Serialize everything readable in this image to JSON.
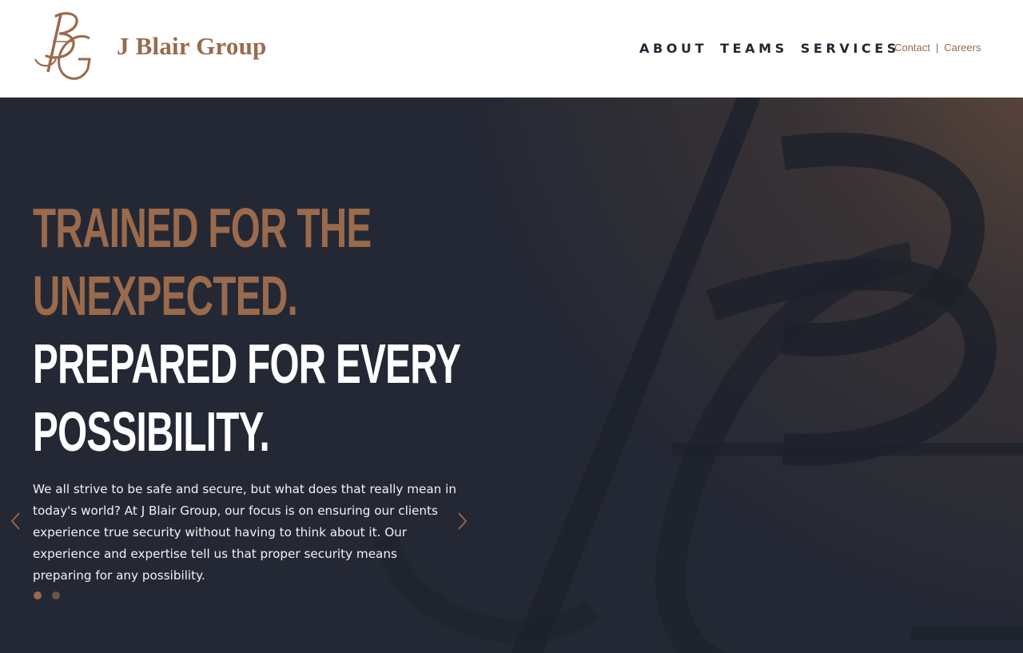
{
  "brand": {
    "monogram_letters": "BG",
    "name": "J Blair Group"
  },
  "nav": {
    "items": [
      {
        "label": "ABOUT"
      },
      {
        "label": "TEAMS"
      },
      {
        "label": "SERVICES"
      }
    ]
  },
  "utility_links": {
    "contact": "Contact",
    "separator": "|",
    "careers": "Careers"
  },
  "hero": {
    "headline_accent_line1": "TRAINED FOR THE",
    "headline_accent_line2": "UNEXPECTED.",
    "headline_light_line1": "PREPARED FOR EVERY",
    "headline_light_line2": "POSSIBILITY.",
    "body": "We all strive to be safe and secure, but what does that really mean in today's world? At J Blair Group, our focus is on ensuring our clients experience true security without having to think about it. Our experience and expertise tell us that proper security means preparing for any possibility.",
    "slides": {
      "count": 2,
      "active": 1
    }
  },
  "icons": {
    "prev": "chevron-left-icon",
    "next": "chevron-right-icon",
    "logo": "bg-monogram-icon",
    "background": "bg-monogram-watermark"
  },
  "colors": {
    "brand_copper": "#9a6a4c",
    "nav_text": "#232733",
    "hero_bg": "#242834",
    "hero_text": "#ffffff",
    "dot_active": "#9a6a4c",
    "dot_inactive": "#6b5546"
  }
}
